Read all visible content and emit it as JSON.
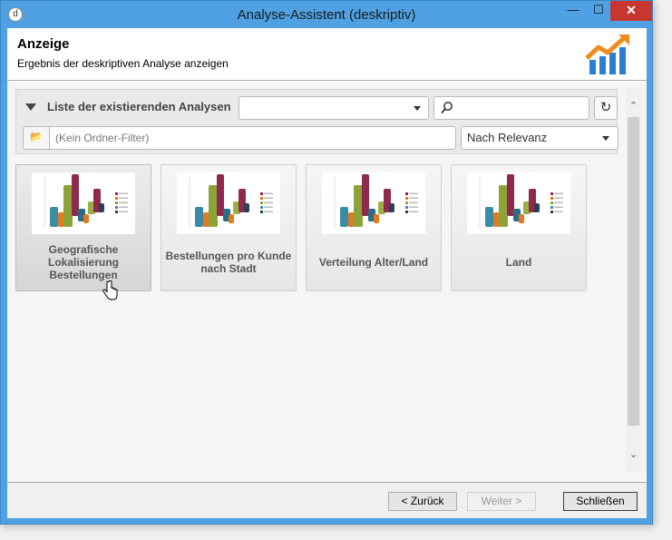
{
  "window": {
    "title": "Analyse-Assistent (deskriptiv)",
    "app_icon": "d",
    "minimize": "—",
    "maximize": "☐",
    "close": "✕"
  },
  "header": {
    "title": "Anzeige",
    "subtitle": "Ergebnis der deskriptiven Analyse anzeigen",
    "logo_icon": "analytics-chart-icon"
  },
  "toolbar": {
    "list_title": "Liste der existierenden Analysen",
    "combo_value": "",
    "search_value": "",
    "folder_filter_placeholder": "(Kein Ordner-Filter)",
    "sort_value": "Nach Relevanz"
  },
  "cards": [
    {
      "label": "Geografische Lokalisierung Bestellungen"
    },
    {
      "label": "Bestellungen pro Kunde nach Stadt"
    },
    {
      "label": "Verteilung Alter/Land"
    },
    {
      "label": "Land"
    }
  ],
  "footer": {
    "back": "< Zurück",
    "next": "Weiter >",
    "close": "Schließen"
  },
  "colors": {
    "titlebar": "#4fa1e3",
    "close_button": "#c7372f",
    "logo_orange": "#f08c1e",
    "logo_blue": "#2a7fd4"
  }
}
